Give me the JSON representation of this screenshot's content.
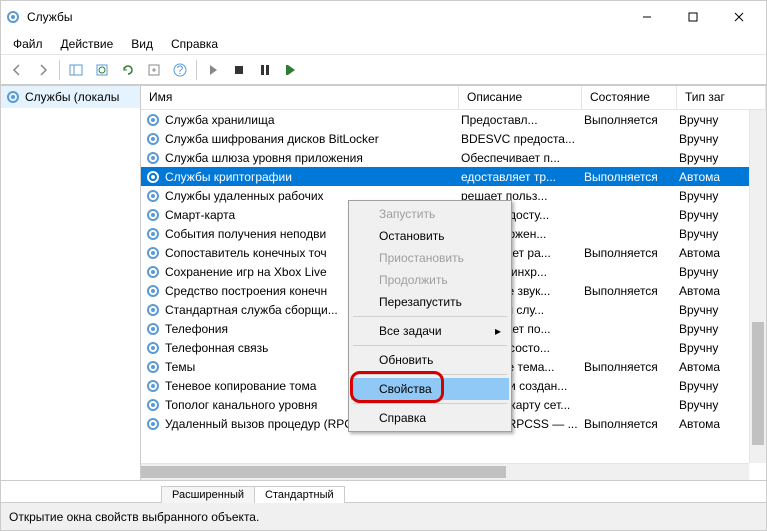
{
  "window": {
    "title": "Службы"
  },
  "menu": {
    "items": [
      "Файл",
      "Действие",
      "Вид",
      "Справка"
    ]
  },
  "left": {
    "label": "Службы (локалы"
  },
  "headers": {
    "name": "Имя",
    "desc": "Описание",
    "state": "Состояние",
    "start": "Тип заг"
  },
  "rows": [
    {
      "name": "Служба хранилища",
      "desc": "Предоставл...",
      "state": "Выполняется",
      "start": "Вручну"
    },
    {
      "name": "Служба шифрования дисков BitLocker",
      "desc": "BDESVC предоста...",
      "state": "",
      "start": "Вручну"
    },
    {
      "name": "Служба шлюза уровня приложения",
      "desc": "Обеспечивает п...",
      "state": "",
      "start": "Вручну"
    },
    {
      "name": "Службы криптографии",
      "desc": "едоставляет тр...",
      "state": "Выполняется",
      "start": "Автома",
      "selected": true
    },
    {
      "name": "Службы удаленных рабочих",
      "desc": "решает польз...",
      "state": "",
      "start": "Вручну"
    },
    {
      "name": "Смарт-карта",
      "desc": "равляет досту...",
      "state": "",
      "start": "Вручну"
    },
    {
      "name": "События получения неподви",
      "desc": "уск приложен...",
      "state": "",
      "start": "Вручну"
    },
    {
      "name": "Сопоставитель конечных точ",
      "desc": "еспечивает ра...",
      "state": "Выполняется",
      "start": "Автома"
    },
    {
      "name": "Сохранение игр на Xbox Live",
      "desc": "служба синхр...",
      "state": "",
      "start": "Вручну"
    },
    {
      "name": "Средство построения конечн",
      "desc": "равление звук...",
      "state": "Выполняется",
      "start": "Автома"
    },
    {
      "name": "Стандартная служба сборщи...",
      "desc": "ндартная слу...",
      "state": "",
      "start": "Вручну"
    },
    {
      "name": "Телефония",
      "desc": "еспечивает по...",
      "state": "",
      "start": "Вручну"
    },
    {
      "name": "Телефонная связь",
      "desc": "равляет состо...",
      "state": "",
      "start": "Вручну"
    },
    {
      "name": "Темы",
      "desc": "равление тема...",
      "state": "Выполняется",
      "start": "Автома"
    },
    {
      "name": "Теневое копирование тома",
      "desc": "равляет и создан...",
      "state": "",
      "start": "Вручну"
    },
    {
      "name": "Тополог канального уровня",
      "desc": "Создает карту сет...",
      "state": "",
      "start": "Вручну"
    },
    {
      "name": "Удаленный вызов процедур (RPC)",
      "desc": "Служба RPCSS — ...",
      "state": "Выполняется",
      "start": "Автома"
    }
  ],
  "tabs": {
    "ext": "Расширенный",
    "std": "Стандартный"
  },
  "status": "Открытие окна свойств выбранного объекта.",
  "context": {
    "items": [
      {
        "label": "Запустить",
        "disabled": true
      },
      {
        "label": "Остановить"
      },
      {
        "label": "Приостановить",
        "disabled": true
      },
      {
        "label": "Продолжить",
        "disabled": true
      },
      {
        "label": "Перезапустить"
      },
      {
        "sep": true
      },
      {
        "label": "Все задачи",
        "submenu": true
      },
      {
        "sep": true
      },
      {
        "label": "Обновить"
      },
      {
        "sep": true
      },
      {
        "label": "Свойства",
        "hover": true
      },
      {
        "sep": true
      },
      {
        "label": "Справка"
      }
    ]
  }
}
